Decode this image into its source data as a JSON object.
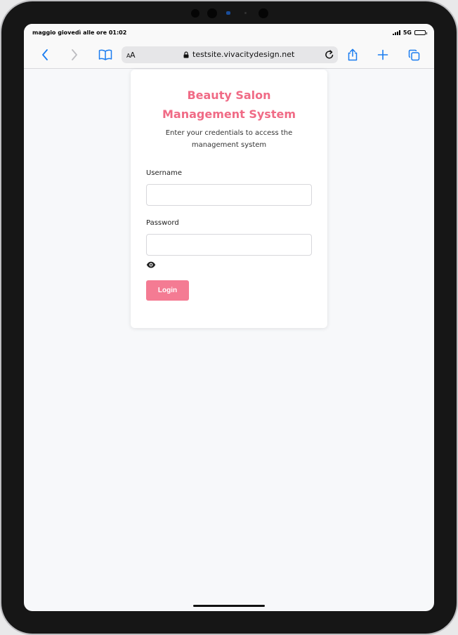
{
  "statusbar": {
    "time_text": "maggio giovedì alle ore 01:02",
    "network": "5G"
  },
  "browser": {
    "text_size_label": "AA",
    "text_size_small": "A",
    "text_size_large": "A",
    "url": "testsite.vivacitydesign.net",
    "accent_color": "#1a7cf0",
    "icons": [
      "back-icon",
      "forward-icon",
      "bookmarks-icon",
      "lock-icon",
      "reload-icon",
      "share-icon",
      "new-tab-icon",
      "tabs-icon"
    ]
  },
  "login": {
    "title": "Beauty Salon Management System",
    "subtitle": "Enter your credentials to access the management system",
    "username_label": "Username",
    "username_value": "",
    "password_label": "Password",
    "password_value": "",
    "login_button": "Login",
    "title_color": "#f06b86",
    "button_color": "#f47b93"
  }
}
